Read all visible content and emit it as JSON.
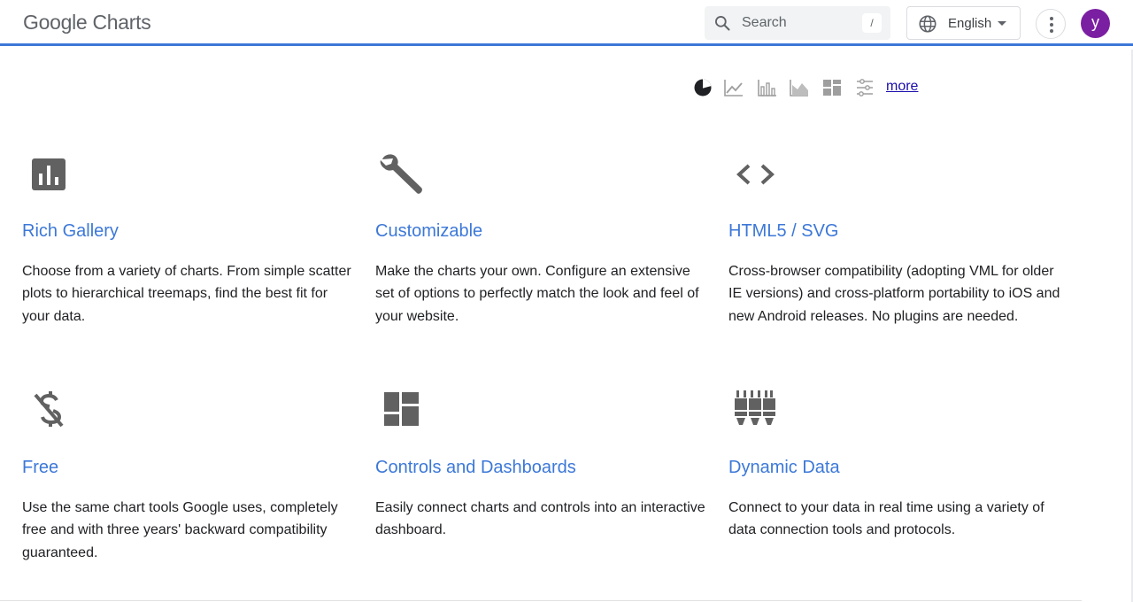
{
  "header": {
    "logo_google": "Google",
    "logo_product": "Charts",
    "search_placeholder": "Search",
    "search_shortcut": "/",
    "language": "English",
    "avatar_letter": "y"
  },
  "chart_strip": {
    "icons": [
      "pie-chart-icon",
      "line-chart-icon",
      "bar-chart-icon",
      "area-chart-icon",
      "treemap-icon",
      "controls-icon"
    ],
    "more_label": "more"
  },
  "features": [
    {
      "icon": "bar-chart-icon",
      "title": "Rich Gallery",
      "description": "Choose from a variety of charts. From simple scatter plots to hierarchical treemaps, find the best fit for your data."
    },
    {
      "icon": "wrench-icon",
      "title": "Customizable",
      "description": "Make the charts your own. Configure an extensive set of options to perfectly match the look and feel of your website."
    },
    {
      "icon": "code-icon",
      "title": "HTML5 / SVG",
      "description": "Cross-browser compatibility (adopting VML for older IE versions) and cross-platform portability to iOS and new Android releases. No plugins are needed."
    },
    {
      "icon": "money-off-icon",
      "title": "Free",
      "description": "Use the same chart tools Google uses, completely free and with three years' backward compatibility guaranteed."
    },
    {
      "icon": "dashboard-icon",
      "title": "Controls and Dashboards",
      "description": "Easily connect charts and controls into an interactive dashboard."
    },
    {
      "icon": "sliders-icon",
      "title": "Dynamic Data",
      "description": "Connect to your data in real time using a variety of data connection tools and protocols."
    }
  ],
  "colors": {
    "accent": "#3c78d8",
    "icon_gray": "#616161",
    "avatar": "#7b1fa2",
    "link": "#1a0dab"
  }
}
